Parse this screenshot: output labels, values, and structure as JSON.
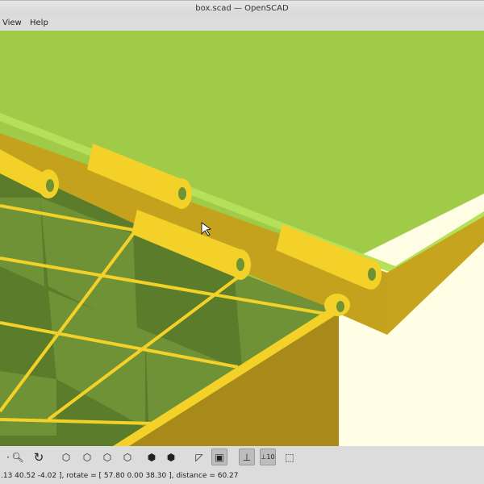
{
  "window": {
    "title": "box.scad — OpenSCAD"
  },
  "menu": {
    "items": [
      "View",
      "Help"
    ]
  },
  "toolbar": {
    "buttons": [
      "zoom-out",
      "reset-view",
      "view-right",
      "view-top",
      "view-bottom",
      "view-left",
      "view-front",
      "view-back",
      "perspective",
      "orthogonal",
      "show-axes",
      "show-scale-markers",
      "show-edges"
    ]
  },
  "status": {
    "text": ".13 40.52 -4.02 ], rotate = [ 57.80 0.00 38.30 ], distance = 60.27"
  },
  "colors": {
    "lid": "#9fcb48",
    "part": "#f4d128",
    "interior": "#5b7c2a",
    "wall": "#b0901c",
    "background": "#fffde4"
  }
}
